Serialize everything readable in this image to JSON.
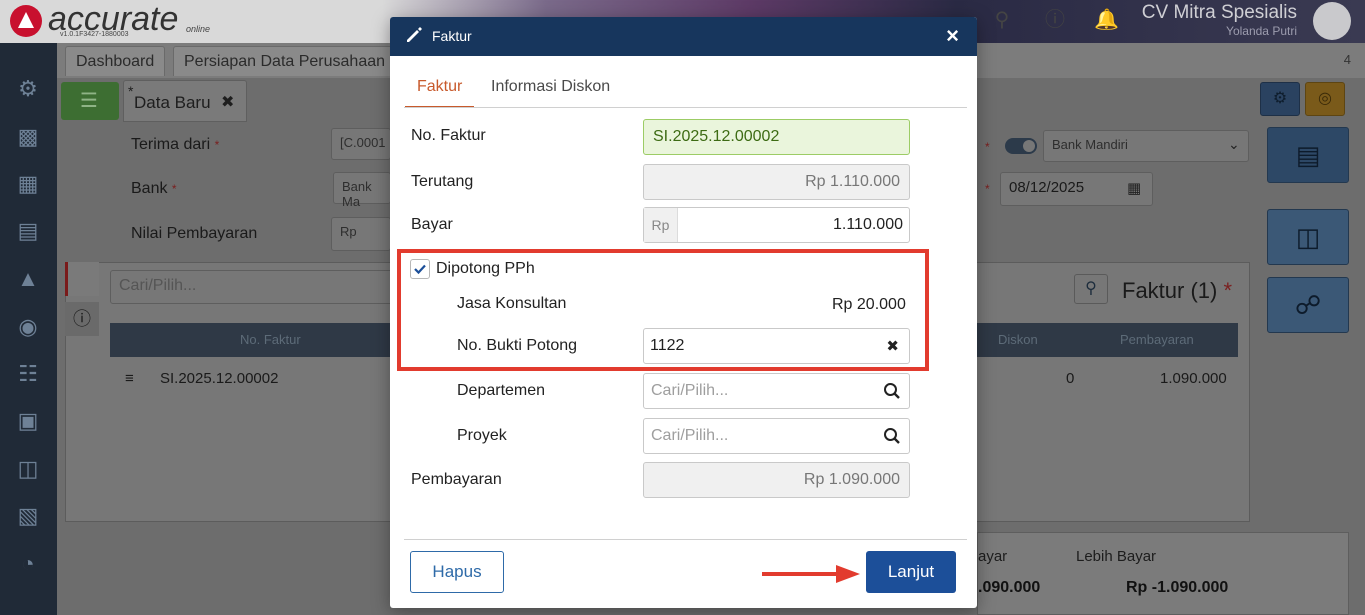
{
  "app": {
    "logo_text": "accurate",
    "logo_version": "v1.0.1F3427-1880003",
    "logo_online": "online",
    "company_name": "CV Mitra Spesialis",
    "user_name": "Yolanda Putri"
  },
  "tabs": [
    {
      "label": "Dashboard"
    },
    {
      "label": "Persiapan Data Perusahaan"
    }
  ],
  "tab_count": "4",
  "document_tab": {
    "marker": "*",
    "label": "Data Baru"
  },
  "form": {
    "terima_dari_label": "Terima dari",
    "terima_dari_value": "[C.0001",
    "bank_label": "Bank",
    "bank_value": "Bank Ma",
    "nilai_label": "Nilai Pembayaran",
    "nilai_prefix": "Rp",
    "required_mark": "*",
    "bank_select": "Bank Mandiri",
    "date": "08/12/2025",
    "search_placeholder": "Cari/Pilih...",
    "faktur_title": "Faktur (1)"
  },
  "grid": {
    "columns": [
      "No. Faktur",
      "Diskon",
      "Pembayaran"
    ],
    "row": {
      "no_faktur": "SI.2025.12.00002",
      "diskon": "0",
      "pembayaran": "1.090.000"
    }
  },
  "summary": {
    "left_label": "ayar",
    "left_value": ".090.000",
    "right_label": "Lebih Bayar",
    "right_value": "Rp -1.090.000"
  },
  "modal": {
    "title": "Faktur",
    "tabs": {
      "faktur": "Faktur",
      "informasi_diskon": "Informasi Diskon"
    },
    "no_faktur_label": "No. Faktur",
    "no_faktur_value": "SI.2025.12.00002",
    "terutang_label": "Terutang",
    "terutang_value": "Rp 1.110.000",
    "bayar_label": "Bayar",
    "bayar_prefix": "Rp",
    "bayar_value": "1.110.000",
    "dipotong_label": "Dipotong PPh",
    "dipotong_checked": true,
    "jasa_label": "Jasa Konsultan",
    "jasa_value": "Rp 20.000",
    "bukti_label": "No. Bukti Potong",
    "bukti_value": "1122",
    "departemen_label": "Departemen",
    "departemen_placeholder": "Cari/Pilih...",
    "proyek_label": "Proyek",
    "proyek_placeholder": "Cari/Pilih...",
    "pembayaran_label": "Pembayaran",
    "pembayaran_value": "Rp 1.090.000",
    "hapus_label": "Hapus",
    "lanjut_label": "Lanjut"
  },
  "colors": {
    "header": "#17365d",
    "active_tab": "#c85a2c",
    "highlight": "#e23b2e",
    "primary_button": "#1c4f99"
  }
}
